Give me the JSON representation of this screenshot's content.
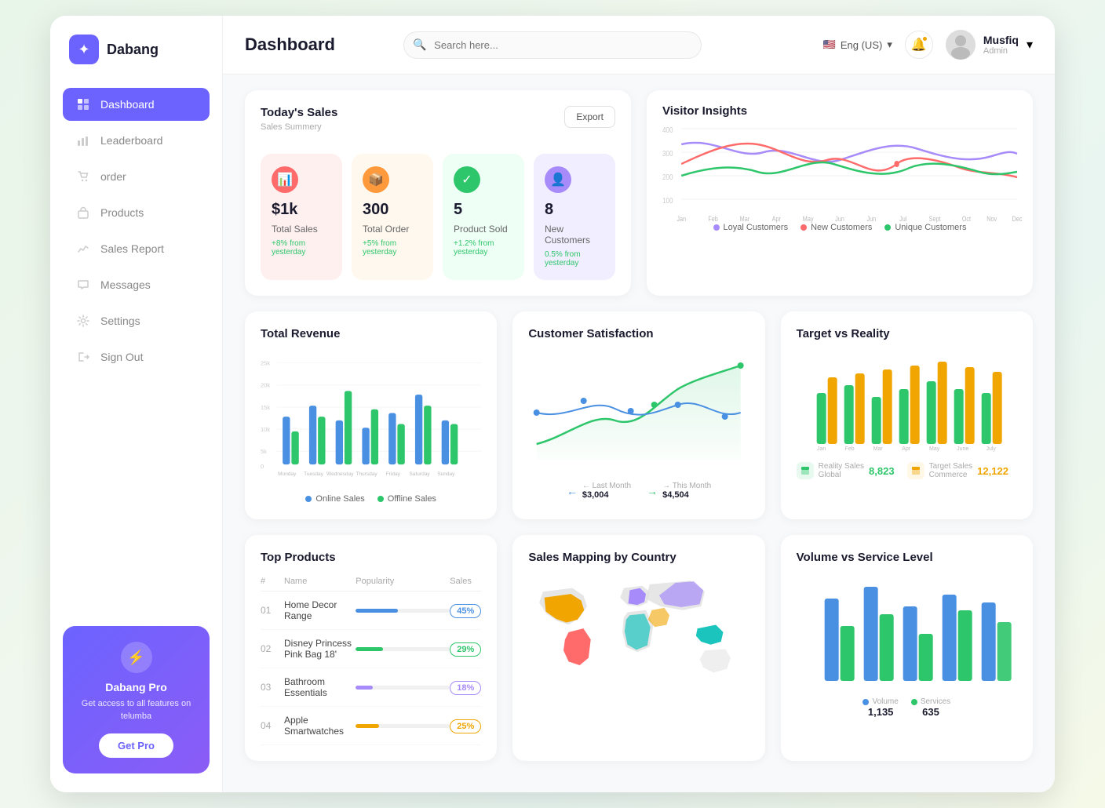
{
  "sidebar": {
    "logo": "Dabang",
    "nav_items": [
      {
        "label": "Dashboard",
        "icon": "📊",
        "active": true
      },
      {
        "label": "Leaderboard",
        "icon": "📈",
        "active": false
      },
      {
        "label": "order",
        "icon": "🛒",
        "active": false
      },
      {
        "label": "Products",
        "icon": "🛍",
        "active": false
      },
      {
        "label": "Sales Report",
        "icon": "📉",
        "active": false
      },
      {
        "label": "Messages",
        "icon": "💬",
        "active": false
      },
      {
        "label": "Settings",
        "icon": "⚙️",
        "active": false
      },
      {
        "label": "Sign Out",
        "icon": "🚪",
        "active": false
      }
    ],
    "promo": {
      "title": "Dabang Pro",
      "desc": "Get access to all features on telumba",
      "btn": "Get Pro"
    }
  },
  "header": {
    "title": "Dashboard",
    "search_placeholder": "Search here...",
    "language": "Eng (US)",
    "user_name": "Musfiq",
    "user_role": "Admin"
  },
  "todays_sales": {
    "title": "Today's Sales",
    "subtitle": "Sales Summery",
    "export_btn": "Export",
    "stats": [
      {
        "value": "$1k",
        "label": "Total Sales",
        "change": "+8% from yesterday",
        "color": "pink"
      },
      {
        "value": "300",
        "label": "Total Order",
        "change": "+5% from yesterday",
        "color": "orange"
      },
      {
        "value": "5",
        "label": "Product Sold",
        "change": "+1.2% from yesterday",
        "color": "green"
      },
      {
        "value": "8",
        "label": "New Customers",
        "change": "0.5% from yesterday",
        "color": "purple"
      }
    ]
  },
  "visitor_insights": {
    "title": "Visitor Insights",
    "legend": [
      {
        "label": "Loyal Customers",
        "color": "#A78BFA"
      },
      {
        "label": "New Customers",
        "color": "#FF6B6B"
      },
      {
        "label": "Unique Customers",
        "color": "#2EC66A"
      }
    ],
    "months": [
      "Jan",
      "Feb",
      "Mar",
      "Apr",
      "May",
      "Jun",
      "Jun",
      "Jul",
      "Sept",
      "Oct",
      "Nov",
      "Dec"
    ]
  },
  "total_revenue": {
    "title": "Total Revenue",
    "days": [
      "Monday",
      "Tuesday",
      "Wednesday",
      "Thursday",
      "Friday",
      "Saturday",
      "Sunday"
    ],
    "legend": [
      {
        "label": "Online Sales",
        "color": "#4A90E2"
      },
      {
        "label": "Offline Sales",
        "color": "#2EC66A"
      }
    ],
    "bars_online": [
      55,
      70,
      50,
      40,
      60,
      80,
      50
    ],
    "bars_offline": [
      40,
      55,
      85,
      65,
      45,
      70,
      45
    ],
    "y_labels": [
      "25k",
      "20k",
      "15k",
      "10k",
      "5k",
      "0"
    ]
  },
  "customer_satisfaction": {
    "title": "Customer Satisfaction",
    "last_month_label": "← Last Month",
    "last_month_value": "$3,004",
    "this_month_label": "→ This Month",
    "this_month_value": "$4,504"
  },
  "target_vs_reality": {
    "title": "Target vs Reality",
    "months": [
      "Jan",
      "Feb",
      "Mar",
      "Apr",
      "May",
      "June",
      "July"
    ],
    "legend": [
      {
        "label": "Reality Sales",
        "sublabel": "Global",
        "value": "8,823",
        "color": "green"
      },
      {
        "label": "Target Sales",
        "sublabel": "Commerce",
        "value": "12,122",
        "color": "yellow"
      }
    ]
  },
  "top_products": {
    "title": "Top Products",
    "columns": [
      "#",
      "Name",
      "Popularity",
      "Sales"
    ],
    "rows": [
      {
        "num": "01",
        "name": "Home Decor Range",
        "popularity": 45,
        "sales": "45%",
        "color": "#4A90E2",
        "badge_color": "#4A90E2"
      },
      {
        "num": "02",
        "name": "Disney Princess Pink Bag 18'",
        "popularity": 29,
        "sales": "29%",
        "color": "#2EC66A",
        "badge_color": "#2EC66A"
      },
      {
        "num": "03",
        "name": "Bathroom Essentials",
        "popularity": 18,
        "sales": "18%",
        "color": "#A78BFA",
        "badge_color": "#A78BFA"
      },
      {
        "num": "04",
        "name": "Apple Smartwatches",
        "popularity": 25,
        "sales": "25%",
        "color": "#F0A500",
        "badge_color": "#F0A500"
      }
    ]
  },
  "sales_mapping": {
    "title": "Sales Mapping by Country"
  },
  "volume_service": {
    "title": "Volume vs Service Level",
    "legend": [
      {
        "label": "Volume",
        "color": "#4A90E2",
        "value": "1,135"
      },
      {
        "label": "Services",
        "color": "#2EC66A",
        "value": "635"
      }
    ],
    "bars": [
      {
        "blue": 80,
        "green": 55
      },
      {
        "blue": 100,
        "green": 65
      },
      {
        "blue": 70,
        "green": 45
      },
      {
        "blue": 90,
        "green": 70
      },
      {
        "blue": 85,
        "green": 50
      }
    ]
  }
}
